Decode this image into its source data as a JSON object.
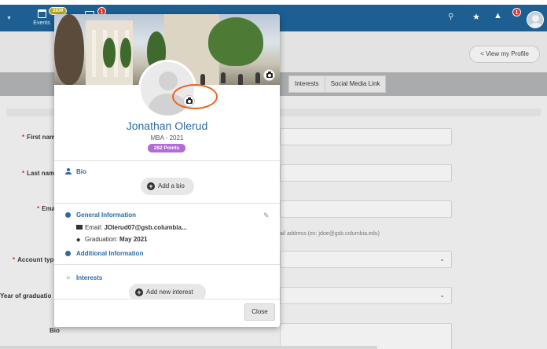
{
  "navbar": {
    "events_label": "Events",
    "events_badge": "2839",
    "messages_badge": "1",
    "notifications_badge": "1",
    "color": "#1d5f93"
  },
  "header": {
    "view_profile_label": "< View my Profile"
  },
  "tabs": [
    "Interests",
    "Social Media Link"
  ],
  "form": {
    "first_name_label": "First nam",
    "last_name_label": "Last nam",
    "email_label": "Ema",
    "email_hint": "ail address (ex: jdoe@gsb.columbia.edu)",
    "account_type_label": "Account typ",
    "year_label": "Year of graduatio",
    "bio_label": "Bio",
    "required_mark": "*"
  },
  "modal": {
    "name": "Jonathan Olerud",
    "program": "MBA - 2021",
    "points": "282 Points",
    "bio_title": "Bio",
    "add_bio_label": "Add a bio",
    "general_title": "General Information",
    "email_label": "Email:",
    "email_value": "JOlerud07@gsb.columbia...",
    "graduation_label": "Graduation:",
    "graduation_value": "May 2021",
    "additional_title": "Additional Information",
    "interests_title": "Interests",
    "add_interest_label": "Add new interest",
    "close_label": "Close",
    "name_color": "#2a6aa7",
    "points_color": "#b46ad8",
    "highlight_color": "#e8661c"
  },
  "icons": {
    "cover_camera": "camera-icon",
    "avatar_camera": "camera-icon",
    "bio": "person-icon",
    "general": "info-icon",
    "edit": "pencil-icon",
    "email": "envelope-icon",
    "graduation": "graduation-cap-icon",
    "interests": "lightbulb-icon",
    "add": "plus-circle-icon"
  }
}
